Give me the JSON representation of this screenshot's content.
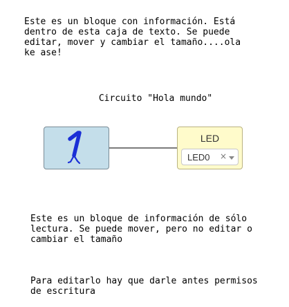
{
  "info_editable": {
    "text": "Este es un bloque con información. Está dentro de esta caja de texto. Se puede editar, mover y cambiar el tamaño....ola ke ase!"
  },
  "circuit": {
    "title": "Circuito \"Hola mundo\""
  },
  "code_block": {
    "icon": "number-one-walking-figure-icon",
    "color": "#c4deea"
  },
  "led_block": {
    "title": "LED",
    "selected_value": "LED0",
    "clear_symbol": "×",
    "color": "#fffbcb"
  },
  "info_readonly": {
    "paragraph1": "Este es un bloque de información de sólo lectura. Se puede mover, pero no editar o cambiar el tamaño",
    "paragraph2": "Para editarlo hay que darle antes permisos de escritura"
  }
}
